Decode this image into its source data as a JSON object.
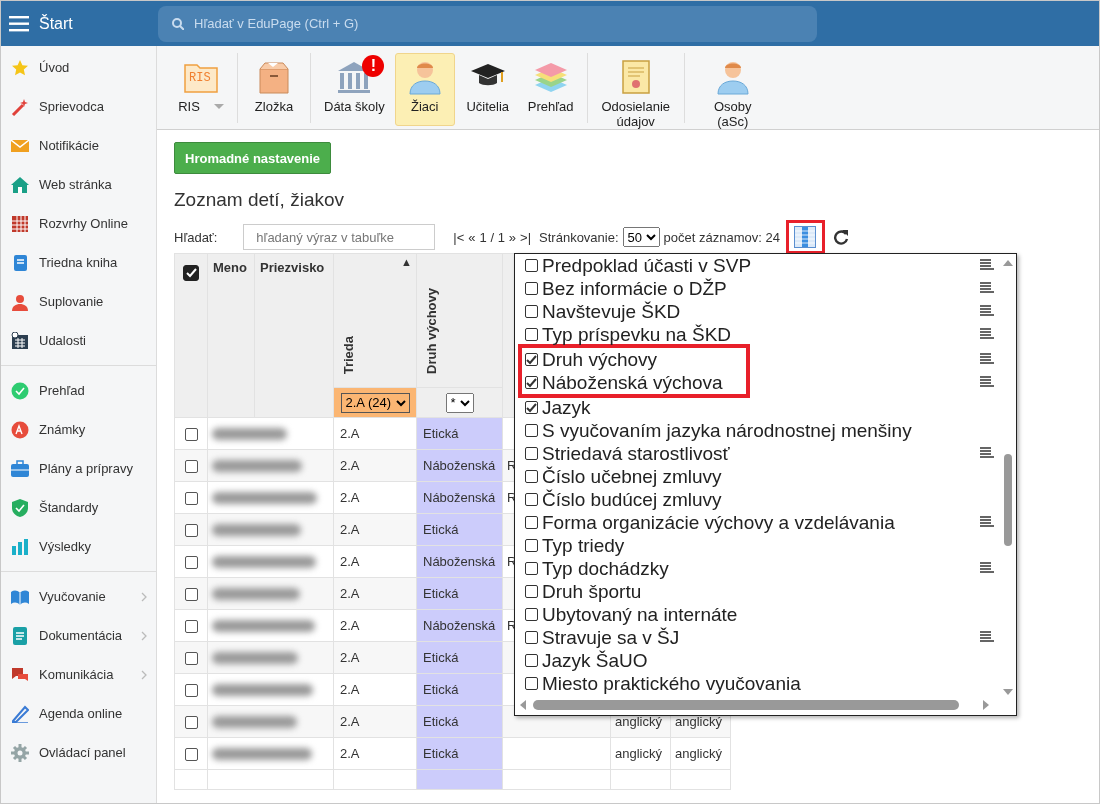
{
  "topbar": {
    "title": "Štart",
    "search_placeholder": "Hľadať v EduPage (Ctrl + G)"
  },
  "sidebar": {
    "sections": [
      {
        "items": [
          {
            "label": "Úvod",
            "expandable": false
          },
          {
            "label": "Sprievodca",
            "expandable": false
          },
          {
            "label": "Notifikácie",
            "expandable": false
          },
          {
            "label": "Web stránka",
            "expandable": false
          },
          {
            "label": "Rozvrhy Online",
            "expandable": false
          },
          {
            "label": "Triedna kniha",
            "expandable": false
          },
          {
            "label": "Suplovanie",
            "expandable": false
          },
          {
            "label": "Udalosti",
            "expandable": false
          }
        ]
      },
      {
        "items": [
          {
            "label": "Prehľad",
            "expandable": false
          },
          {
            "label": "Známky",
            "expandable": false
          },
          {
            "label": "Plány a prípravy",
            "expandable": false
          },
          {
            "label": "Štandardy",
            "expandable": false
          },
          {
            "label": "Výsledky",
            "expandable": false
          }
        ]
      },
      {
        "items": [
          {
            "label": "Vyučovanie",
            "expandable": true
          },
          {
            "label": "Dokumentácia",
            "expandable": true
          },
          {
            "label": "Komunikácia",
            "expandable": true
          },
          {
            "label": "Agenda online",
            "expandable": false
          },
          {
            "label": "Ovládací panel",
            "expandable": false
          }
        ]
      }
    ]
  },
  "toolbar": {
    "groups": [
      {
        "buttons": [
          {
            "label": "RIS",
            "icon_text": "RIS",
            "dropdown": true,
            "selected": false
          }
        ]
      },
      {
        "buttons": [
          {
            "label": "Zložka",
            "dropdown": false,
            "selected": false
          }
        ]
      },
      {
        "buttons": [
          {
            "label": "Dáta školy",
            "alert": "!",
            "dropdown": false,
            "selected": false
          },
          {
            "label": "Žiaci",
            "dropdown": false,
            "selected": true
          },
          {
            "label": "Učitelia",
            "dropdown": false,
            "selected": false
          },
          {
            "label": "Prehľad",
            "dropdown": false,
            "selected": false
          }
        ]
      },
      {
        "buttons": [
          {
            "label": "Odosielanie údajov",
            "dropdown": false,
            "selected": false
          }
        ]
      },
      {
        "buttons": [
          {
            "label": "Osoby (aSc)",
            "dropdown": false,
            "selected": false
          }
        ]
      }
    ]
  },
  "main": {
    "bulk_button": "Hromadné nastavenie",
    "title": "Zoznam detí, žiakov",
    "search": {
      "label": "Hľadať:",
      "placeholder": "hľadaný výraz v tabuľke"
    },
    "pager": {
      "first": "|<",
      "prev": "«",
      "page": "1 / 1",
      "next": "»",
      "last": ">|",
      "paging_label": "Stránkovanie:",
      "page_size": "50",
      "count": "počet záznamov: 24"
    },
    "columns_button": {
      "highlighted": true
    }
  },
  "table": {
    "select_all_checked": true,
    "columns": [
      {
        "label": "Meno",
        "vertical": false
      },
      {
        "label": "Priezvisko",
        "vertical": false
      },
      {
        "label": "Trieda",
        "vertical": true,
        "sort": "▲",
        "filter": "2.A (24)",
        "filter_active": true
      },
      {
        "label": "Druh výchovy",
        "vertical": true,
        "filter": "*",
        "filter_active": false
      }
    ],
    "rows": [
      {
        "checked": false,
        "trieda": "2.A",
        "druh_vychovy": "Etická"
      },
      {
        "checked": false,
        "trieda": "2.A",
        "druh_vychovy": "Náboženská",
        "column_3": "R"
      },
      {
        "checked": false,
        "trieda": "2.A",
        "druh_vychovy": "Náboženská",
        "column_3": "R"
      },
      {
        "checked": false,
        "trieda": "2.A",
        "druh_vychovy": "Etická"
      },
      {
        "checked": false,
        "trieda": "2.A",
        "druh_vychovy": "Náboženská",
        "column_3": "R"
      },
      {
        "checked": false,
        "trieda": "2.A",
        "druh_vychovy": "Etická"
      },
      {
        "checked": false,
        "trieda": "2.A",
        "druh_vychovy": "Náboženská",
        "column_3": "R"
      },
      {
        "checked": false,
        "trieda": "2.A",
        "druh_vychovy": "Etická"
      },
      {
        "checked": false,
        "trieda": "2.A",
        "druh_vychovy": "Etická"
      },
      {
        "checked": false,
        "trieda": "2.A",
        "druh_vychovy": "Etická",
        "column_4": "anglický",
        "column_5": "anglický"
      },
      {
        "checked": false,
        "trieda": "2.A",
        "druh_vychovy": "Etická",
        "column_4": "anglický",
        "column_5": "anglický"
      }
    ]
  },
  "column_popup": {
    "items": [
      {
        "label": "Predpoklad účasti v SVP",
        "checked": false,
        "lines_icon": true,
        "highlighted": false
      },
      {
        "label": "Bez informácie o DŽP",
        "checked": false,
        "lines_icon": true,
        "highlighted": false
      },
      {
        "label": "Navštevuje ŠKD",
        "checked": false,
        "lines_icon": true,
        "highlighted": false
      },
      {
        "label": "Typ príspevku na ŠKD",
        "checked": false,
        "lines_icon": true,
        "highlighted": false
      },
      {
        "label": "Druh výchovy",
        "checked": true,
        "lines_icon": true,
        "highlighted": true
      },
      {
        "label": "Náboženská výchova",
        "checked": true,
        "lines_icon": true,
        "highlighted": true
      },
      {
        "label": "Jazyk",
        "checked": true,
        "lines_icon": false,
        "highlighted": false
      },
      {
        "label": "S vyučovaním jazyka národnostnej menšiny",
        "checked": false,
        "lines_icon": false,
        "highlighted": false
      },
      {
        "label": "Striedavá starostlivosť",
        "checked": false,
        "lines_icon": true,
        "highlighted": false
      },
      {
        "label": "Číslo učebnej zmluvy",
        "checked": false,
        "lines_icon": false,
        "highlighted": false
      },
      {
        "label": "Číslo budúcej zmluvy",
        "checked": false,
        "lines_icon": false,
        "highlighted": false
      },
      {
        "label": "Forma organizácie výchovy a vzdelávania",
        "checked": false,
        "lines_icon": true,
        "highlighted": false
      },
      {
        "label": "Typ triedy",
        "checked": false,
        "lines_icon": false,
        "highlighted": false
      },
      {
        "label": "Typ dochádzky",
        "checked": false,
        "lines_icon": true,
        "highlighted": false
      },
      {
        "label": "Druh športu",
        "checked": false,
        "lines_icon": false,
        "highlighted": false
      },
      {
        "label": "Ubytovaný na internáte",
        "checked": false,
        "lines_icon": false,
        "highlighted": false
      },
      {
        "label": "Stravuje sa v ŠJ",
        "checked": false,
        "lines_icon": true,
        "highlighted": false
      },
      {
        "label": "Jazyk ŠaUO",
        "checked": false,
        "lines_icon": false,
        "highlighted": false
      },
      {
        "label": "Miesto praktického vyučovania",
        "checked": false,
        "lines_icon": false,
        "highlighted": false
      }
    ]
  }
}
